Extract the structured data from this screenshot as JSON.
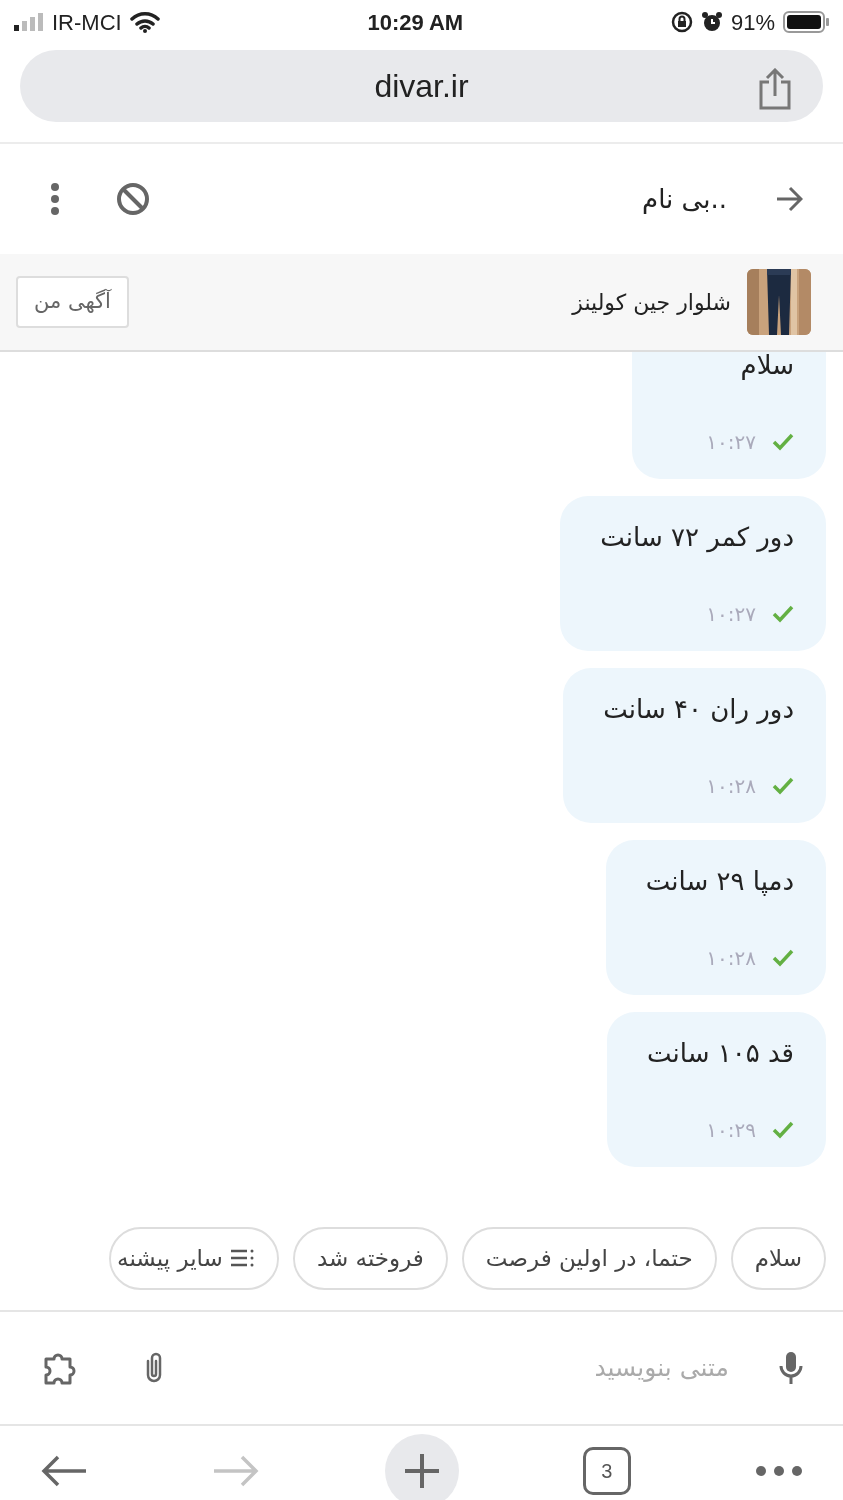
{
  "status_bar": {
    "carrier": "IR-MCI",
    "time": "10:29 AM",
    "battery": "91%"
  },
  "browser": {
    "address": "divar.ir"
  },
  "chat_header": {
    "title": "بی نام.."
  },
  "ad": {
    "title": "شلوار جین کولینز",
    "button": "آگهی من"
  },
  "messages": [
    {
      "text": "سلام",
      "time": "۱۰:۲۷",
      "delivered": true
    },
    {
      "text": "دور کمر ۷۲ سانت",
      "time": "۱۰:۲۷",
      "delivered": true
    },
    {
      "text": "دور ران ۴۰ سانت",
      "time": "۱۰:۲۸",
      "delivered": true
    },
    {
      "text": "دمپا ۲۹ سانت",
      "time": "۱۰:۲۸",
      "delivered": true
    },
    {
      "text": "قد ۱۰۵ سانت",
      "time": "۱۰:۲۹",
      "delivered": true
    }
  ],
  "suggestions": [
    {
      "kind": "reply",
      "label": "سلام"
    },
    {
      "kind": "reply",
      "label": "حتما، در اولین فرصت"
    },
    {
      "kind": "reply",
      "label": "فروخته شد"
    },
    {
      "kind": "more",
      "label": "سایر پیشنه"
    }
  ],
  "composer": {
    "placeholder": "متنی بنویسید"
  },
  "toolbar": {
    "back_disabled": false,
    "forward_disabled": true,
    "tabs_count": "3"
  }
}
